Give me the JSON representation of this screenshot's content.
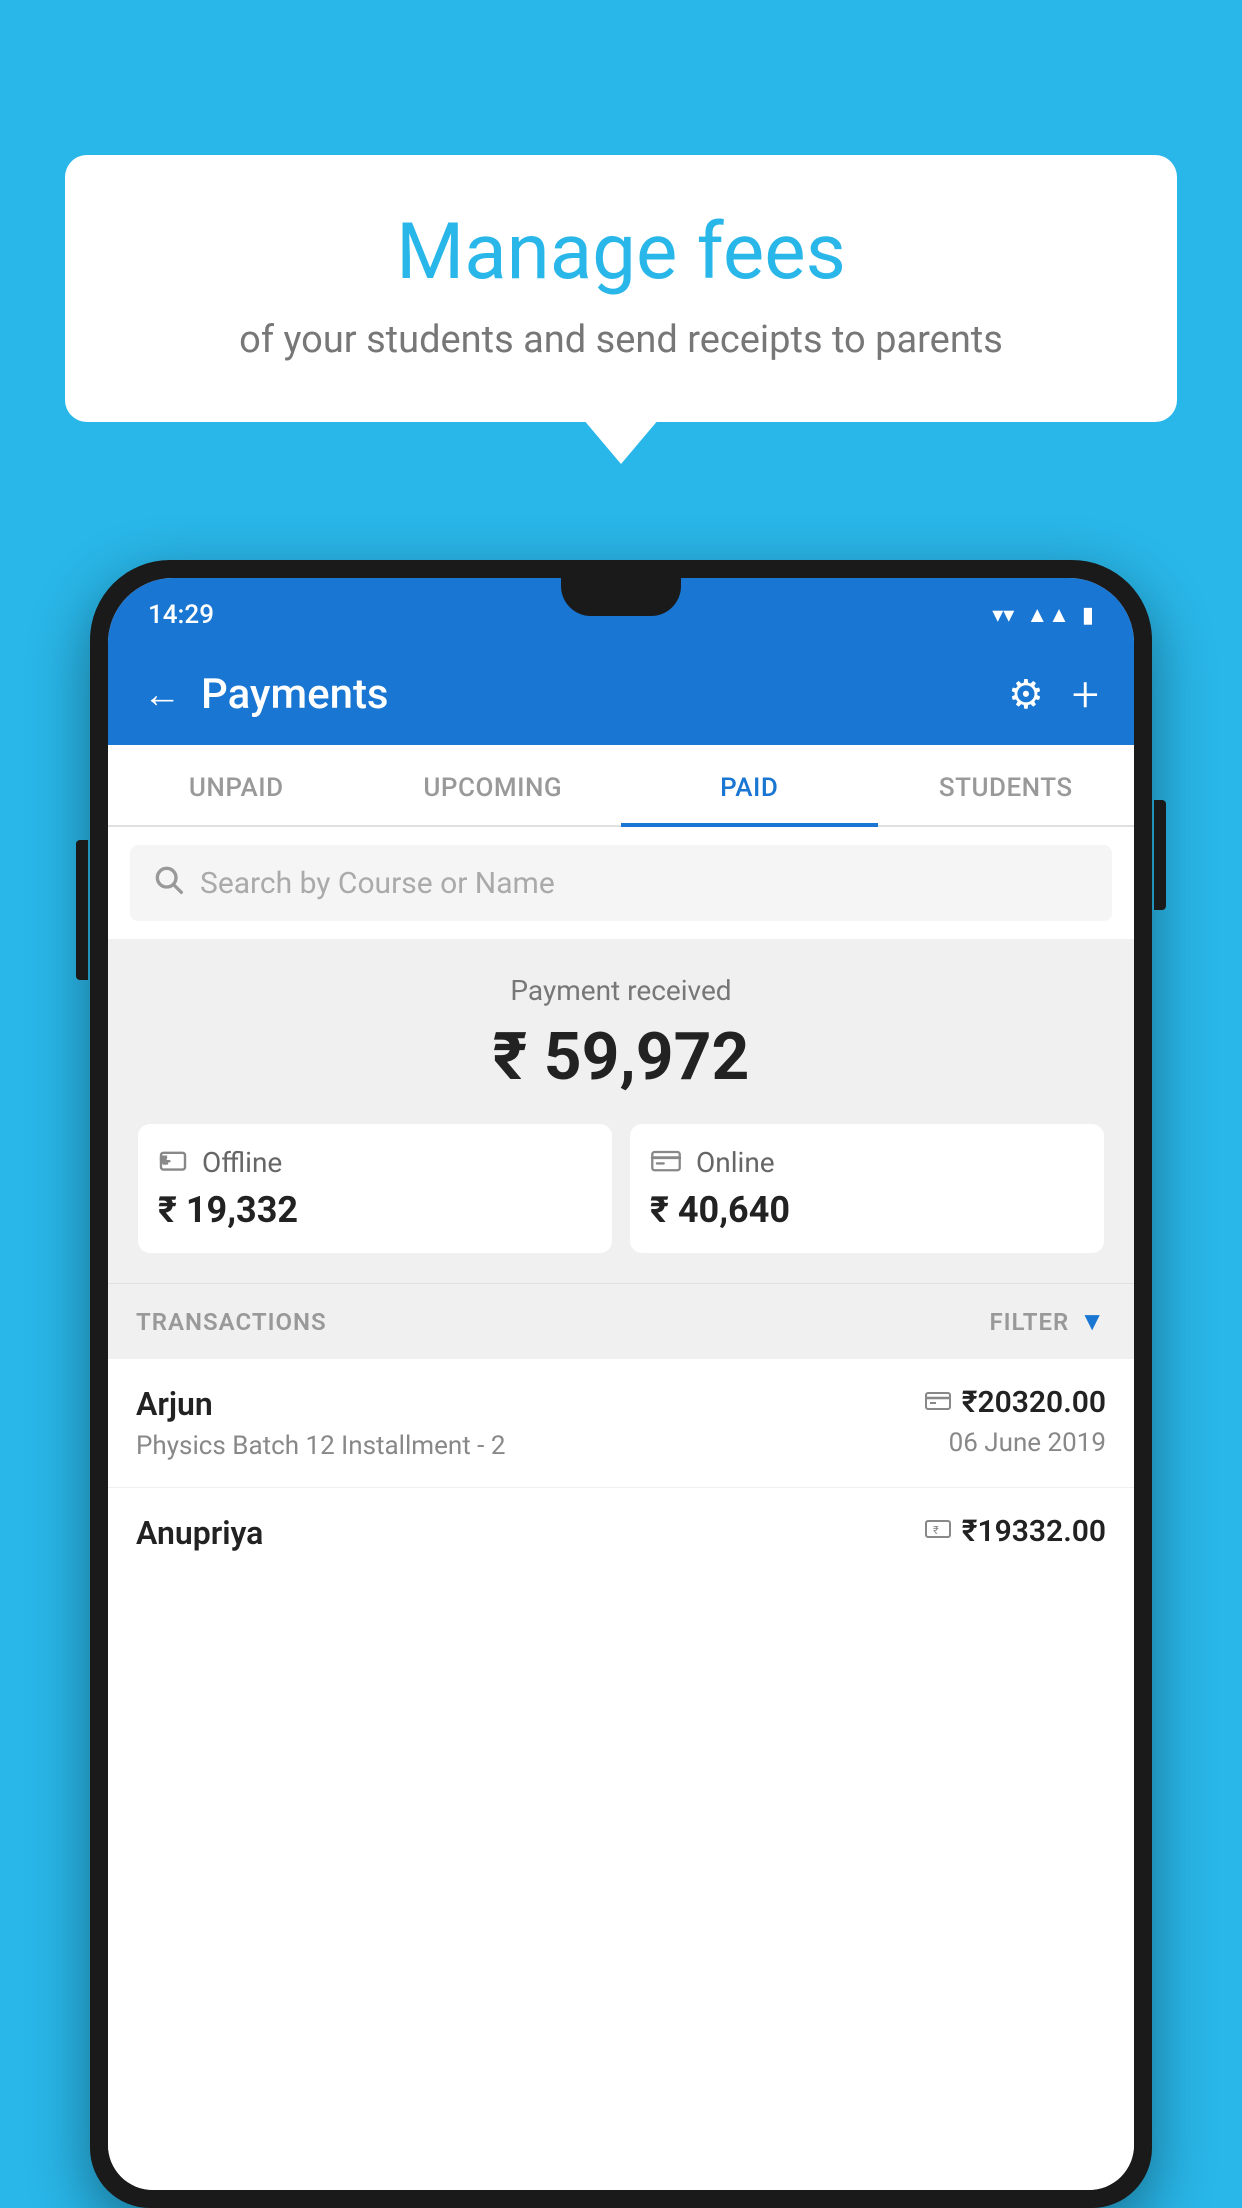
{
  "background_color": "#29b6e8",
  "bubble": {
    "title": "Manage fees",
    "subtitle": "of your students and send receipts to parents"
  },
  "status_bar": {
    "time": "14:29",
    "wifi": "▼",
    "signal": "▲",
    "battery": "▮"
  },
  "header": {
    "title": "Payments",
    "back_label": "←",
    "settings_label": "⚙",
    "add_label": "+"
  },
  "tabs": [
    {
      "id": "unpaid",
      "label": "UNPAID",
      "active": false
    },
    {
      "id": "upcoming",
      "label": "UPCOMING",
      "active": false
    },
    {
      "id": "paid",
      "label": "PAID",
      "active": true
    },
    {
      "id": "students",
      "label": "STUDENTS",
      "active": false
    }
  ],
  "search": {
    "placeholder": "Search by Course or Name"
  },
  "payment_summary": {
    "label": "Payment received",
    "total": "₹ 59,972",
    "offline_label": "Offline",
    "offline_amount": "₹ 19,332",
    "online_label": "Online",
    "online_amount": "₹ 40,640"
  },
  "transactions": {
    "section_label": "TRANSACTIONS",
    "filter_label": "FILTER",
    "items": [
      {
        "name": "Arjun",
        "course": "Physics Batch 12 Installment - 2",
        "type_icon": "card",
        "amount": "₹20320.00",
        "date": "06 June 2019"
      },
      {
        "name": "Anupriya",
        "course": "",
        "type_icon": "cash",
        "amount": "₹19332.00",
        "date": ""
      }
    ]
  }
}
